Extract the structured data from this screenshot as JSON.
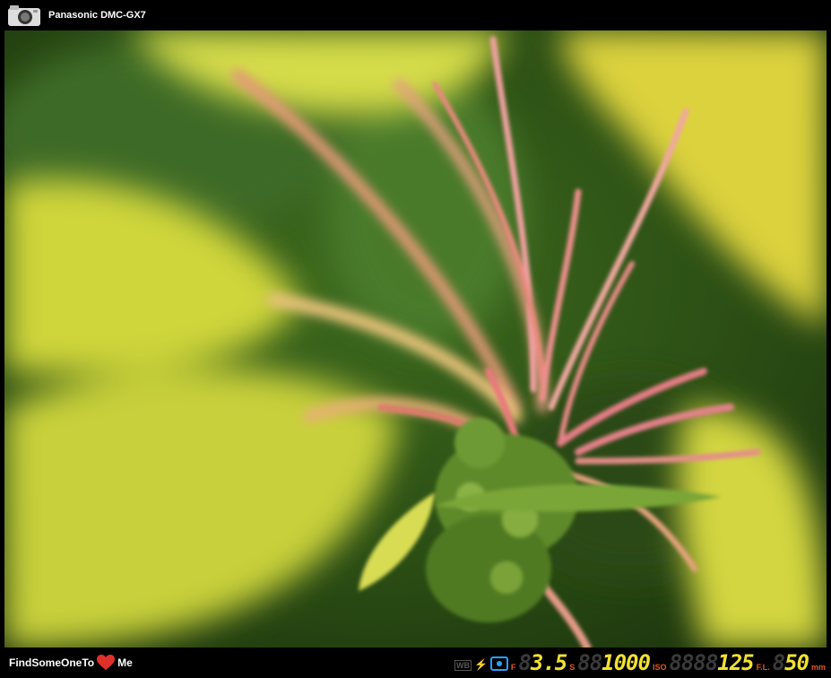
{
  "camera": {
    "model": "Panasonic DMC-GX7",
    "icon": "camera-icon"
  },
  "brand": {
    "left": "FindSomeOneTo",
    "right": "Me",
    "icon": "heart-icon"
  },
  "exif": {
    "wb_label": "WB",
    "aperture_unit": "F",
    "aperture_ghost": "8",
    "aperture_value": "3.5",
    "shutter_unit": "S",
    "shutter_ghost": "88",
    "shutter_value": "1000",
    "iso_unit": "ISO",
    "iso_ghost": "8888",
    "iso_value": "125",
    "focal_unit": "F.L.",
    "focal_ghost": "8",
    "focal_value": "50",
    "focal_suffix": "mm"
  },
  "photo": {
    "subject": "macro-plant-flower",
    "colors": {
      "leaf": "#d8e23a",
      "stem": "#e8707a",
      "dark": "#1f3a12"
    }
  }
}
